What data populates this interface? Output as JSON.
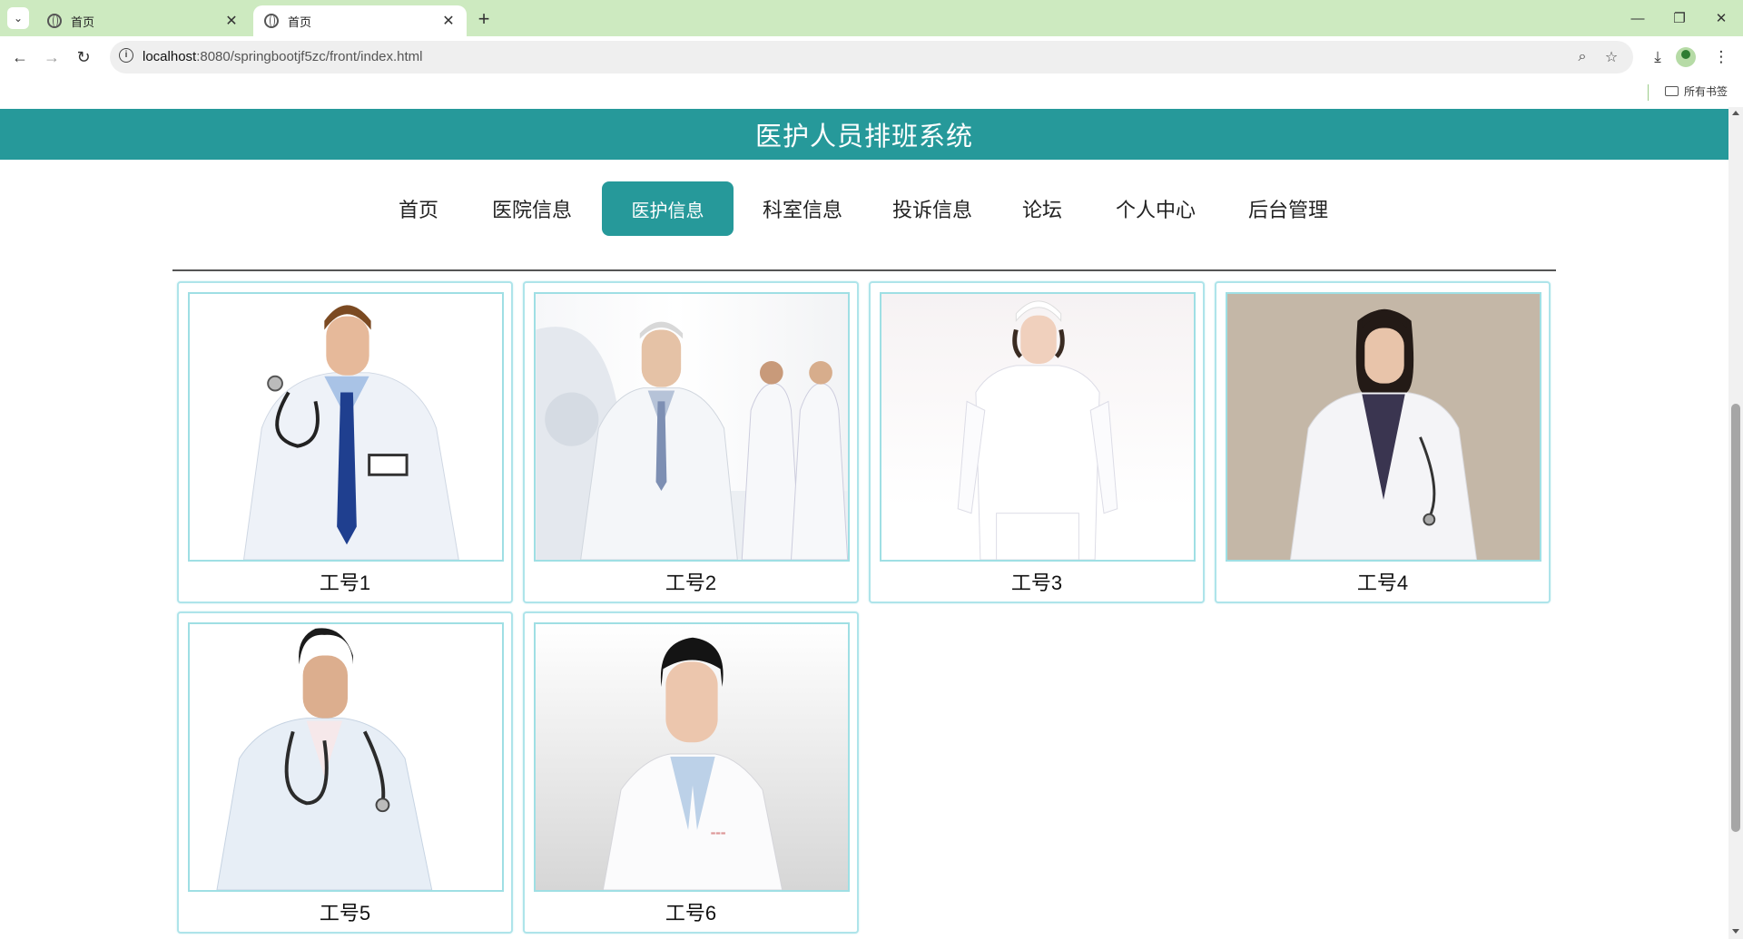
{
  "browser": {
    "tabs": [
      {
        "title": "首页",
        "active": false
      },
      {
        "title": "首页",
        "active": true
      }
    ],
    "url_host": "localhost",
    "url_rest": ":8080/springbootjf5zc/front/index.html",
    "bookmarks_folder": "所有书签"
  },
  "site": {
    "title": "医护人员排班系统",
    "nav": [
      {
        "label": "首页",
        "active": false
      },
      {
        "label": "医院信息",
        "active": false
      },
      {
        "label": "医护信息",
        "active": true
      },
      {
        "label": "科室信息",
        "active": false
      },
      {
        "label": "投诉信息",
        "active": false
      },
      {
        "label": "论坛",
        "active": false
      },
      {
        "label": "个人中心",
        "active": false
      },
      {
        "label": "后台管理",
        "active": false
      }
    ],
    "staff": [
      {
        "caption": "工号1",
        "photo": "male-doctor-stethoscope"
      },
      {
        "caption": "工号2",
        "photo": "senior-doctor-ct-room"
      },
      {
        "caption": "工号3",
        "photo": "nurse-white-uniform"
      },
      {
        "caption": "工号4",
        "photo": "female-doctor"
      },
      {
        "caption": "工号5",
        "photo": "young-male-doctor"
      },
      {
        "caption": "工号6",
        "photo": "male-doctor-portrait"
      }
    ]
  },
  "colors": {
    "accent": "#26999a",
    "tab_bar": "#cdeac0",
    "card_border": "#aee4ea"
  }
}
